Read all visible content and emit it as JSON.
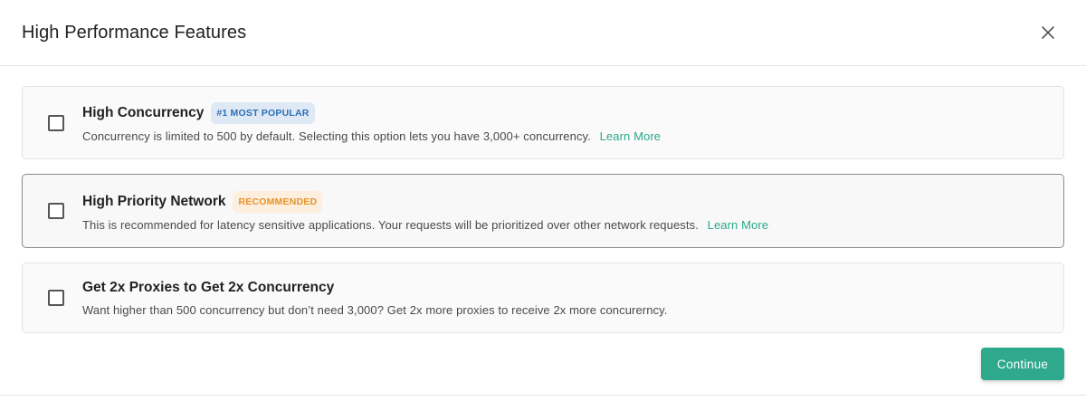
{
  "modal": {
    "title": "High Performance Features",
    "close_icon": "close-icon"
  },
  "options": [
    {
      "title": "High Concurrency",
      "badge": "#1 MOST POPULAR",
      "description": "Concurrency is limited to 500 by default. Selecting this option lets you have 3,000+ concurrency.",
      "link": "Learn More",
      "checked": false
    },
    {
      "title": "High Priority Network",
      "badge": "RECOMMENDED",
      "description": "This is recommended for latency sensitive applications. Your requests will be prioritized over other network requests.",
      "link": "Learn More",
      "checked": false
    },
    {
      "title": "Get 2x Proxies to Get 2x Concurrency",
      "description": "Want higher than 500 concurrency but don’t need 3,000? Get 2x more proxies to receive 2x more concurerncy.",
      "checked": false
    }
  ],
  "footer": {
    "continue_label": "Continue"
  },
  "colors": {
    "accent": "#2ea98c",
    "link": "#2aa889",
    "popular_badge_bg": "#dfe9f5",
    "popular_badge_text": "#2c6fb5",
    "recommended_badge_bg": "#fdeedd",
    "recommended_badge_text": "#e6932a"
  }
}
